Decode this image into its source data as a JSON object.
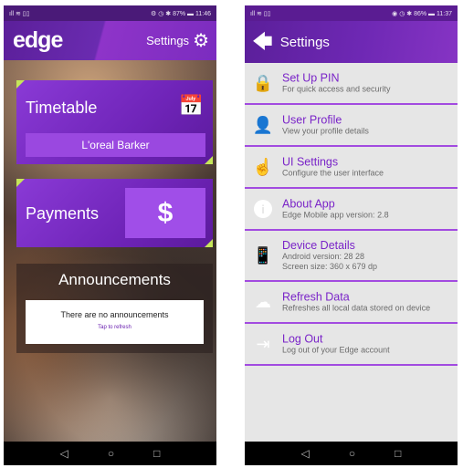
{
  "left": {
    "status": {
      "left": "ıll ≋ ▯▯",
      "right": "⚙ ◷ ✱ 87% ▬ 11:46"
    },
    "logo": "edge",
    "settings_label": "Settings",
    "timetable": {
      "title": "Timetable",
      "student_name": "L'oreal Barker"
    },
    "payments": {
      "title": "Payments",
      "symbol": "$"
    },
    "announcements": {
      "title": "Announcements",
      "message": "There are no announcements",
      "tap": "Tap to refresh"
    }
  },
  "right": {
    "status": {
      "left": "ıll ≋ ▯▯",
      "right": "◉ ◷ ✱ 86% ▬ 11:37"
    },
    "title": "Settings",
    "items": [
      {
        "icon": "lock-icon",
        "label": "Set Up PIN",
        "desc": "For quick access and security"
      },
      {
        "icon": "user-icon",
        "label": "User Profile",
        "desc": "View your profile details"
      },
      {
        "icon": "hand-pointer-icon",
        "label": "UI Settings",
        "desc": "Configure the user interface"
      },
      {
        "icon": "info-icon",
        "label": "About App",
        "desc": "Edge Mobile app version: 2.8"
      },
      {
        "icon": "phone-icon",
        "label": "Device Details",
        "desc": "Android version: 28 28",
        "desc2": "Screen size: 360 x 679 dp"
      },
      {
        "icon": "cloud-download-icon",
        "label": "Refresh Data",
        "desc": "Refreshes all local data stored on device"
      },
      {
        "icon": "logout-icon",
        "label": "Log Out",
        "desc": "Log out of your Edge account"
      }
    ]
  },
  "colors": {
    "accent": "#7a24c8",
    "divider": "#a24be0",
    "highlight": "#c6e65a"
  }
}
